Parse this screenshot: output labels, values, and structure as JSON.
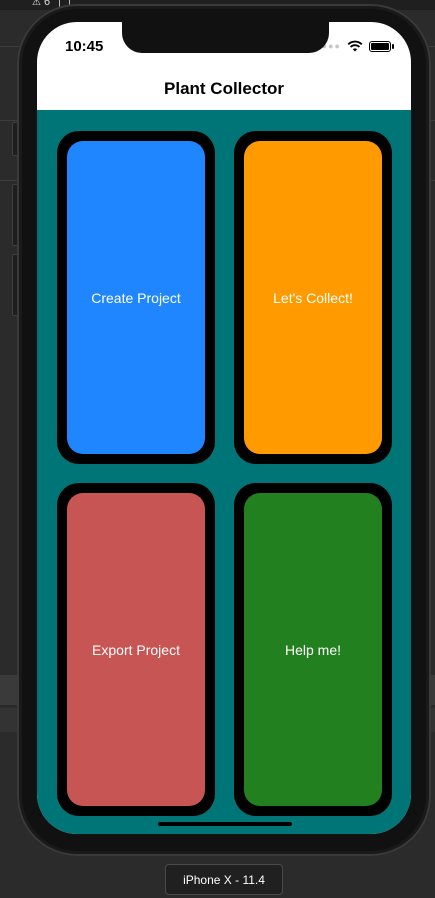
{
  "editor": {
    "warning_count": "6"
  },
  "status_bar": {
    "time": "10:45"
  },
  "nav": {
    "title": "Plant Collector"
  },
  "tiles": [
    {
      "label": "Create Project",
      "color": "#1f86ff"
    },
    {
      "label": "Let's Collect!",
      "color": "#ff9a00"
    },
    {
      "label": "Export Project",
      "color": "#c75554"
    },
    {
      "label": "Help me!",
      "color": "#23801f"
    }
  ],
  "theme": {
    "content_background": "#007578",
    "tile_border": "#000000"
  },
  "device_label": "iPhone X - 11.4"
}
